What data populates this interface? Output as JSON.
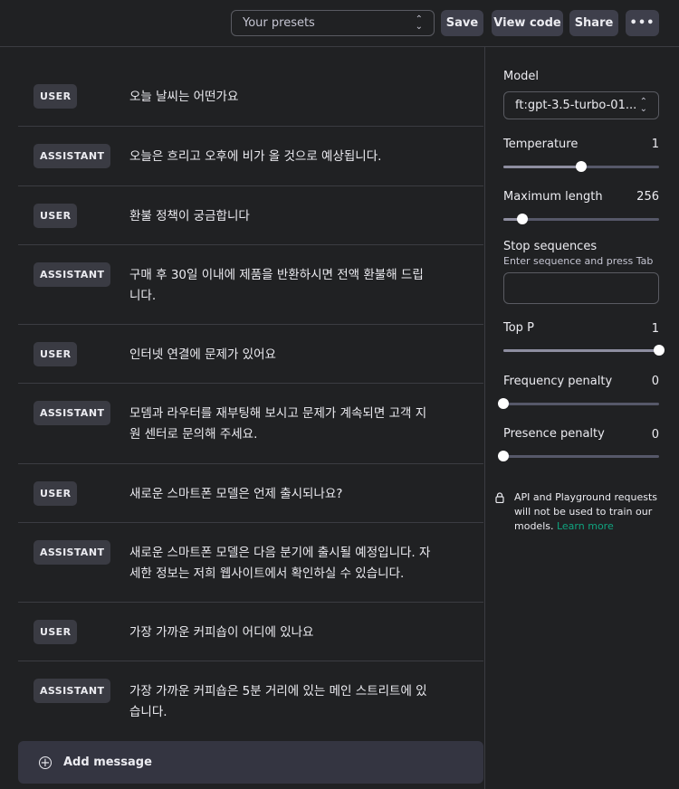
{
  "topbar": {
    "presets_placeholder": "Your presets",
    "save_label": "Save",
    "view_code_label": "View code",
    "share_label": "Share",
    "more_label": "•••"
  },
  "messages": [
    {
      "role": "USER",
      "text": "오늘 날씨는 어떤가요"
    },
    {
      "role": "ASSISTANT",
      "text": "오늘은 흐리고 오후에 비가 올 것으로 예상됩니다."
    },
    {
      "role": "USER",
      "text": "환불 정책이 궁금합니다"
    },
    {
      "role": "ASSISTANT",
      "text": "구매 후 30일 이내에 제품을 반환하시면 전액 환불해 드립니다."
    },
    {
      "role": "USER",
      "text": "인터넷 연결에 문제가 있어요"
    },
    {
      "role": "ASSISTANT",
      "text": "모뎀과 라우터를 재부팅해 보시고 문제가 계속되면 고객 지원 센터로 문의해 주세요."
    },
    {
      "role": "USER",
      "text": "새로운 스마트폰 모델은 언제 출시되나요?"
    },
    {
      "role": "ASSISTANT",
      "text": "새로운 스마트폰 모델은 다음 분기에 출시될 예정입니다. 자세한 정보는 저희 웹사이트에서 확인하실 수 있습니다."
    },
    {
      "role": "USER",
      "text": "가장 가까운 커피숍이 어디에 있나요"
    },
    {
      "role": "ASSISTANT",
      "text": "가장 가까운 커피숍은 5분 거리에 있는 메인 스트리트에 있습니다."
    }
  ],
  "add_message_label": "Add message",
  "settings": {
    "model_label": "Model",
    "model_value": "ft:gpt-3.5-turbo-01...",
    "temperature": {
      "label": "Temperature",
      "value": "1",
      "fraction": 0.5
    },
    "max_length": {
      "label": "Maximum length",
      "value": "256",
      "fraction": 0.12
    },
    "stop_sequences": {
      "label": "Stop sequences",
      "hint": "Enter sequence and press Tab"
    },
    "top_p": {
      "label": "Top P",
      "value": "1",
      "fraction": 1.0
    },
    "frequency_penalty": {
      "label": "Frequency penalty",
      "value": "0",
      "fraction": 0
    },
    "presence_penalty": {
      "label": "Presence penalty",
      "value": "0",
      "fraction": 0
    },
    "privacy_note": "API and Playground requests will not be used to train our models.",
    "learn_more": "Learn more"
  },
  "colors": {
    "background": "#202123",
    "accent_link": "#10a37f"
  }
}
